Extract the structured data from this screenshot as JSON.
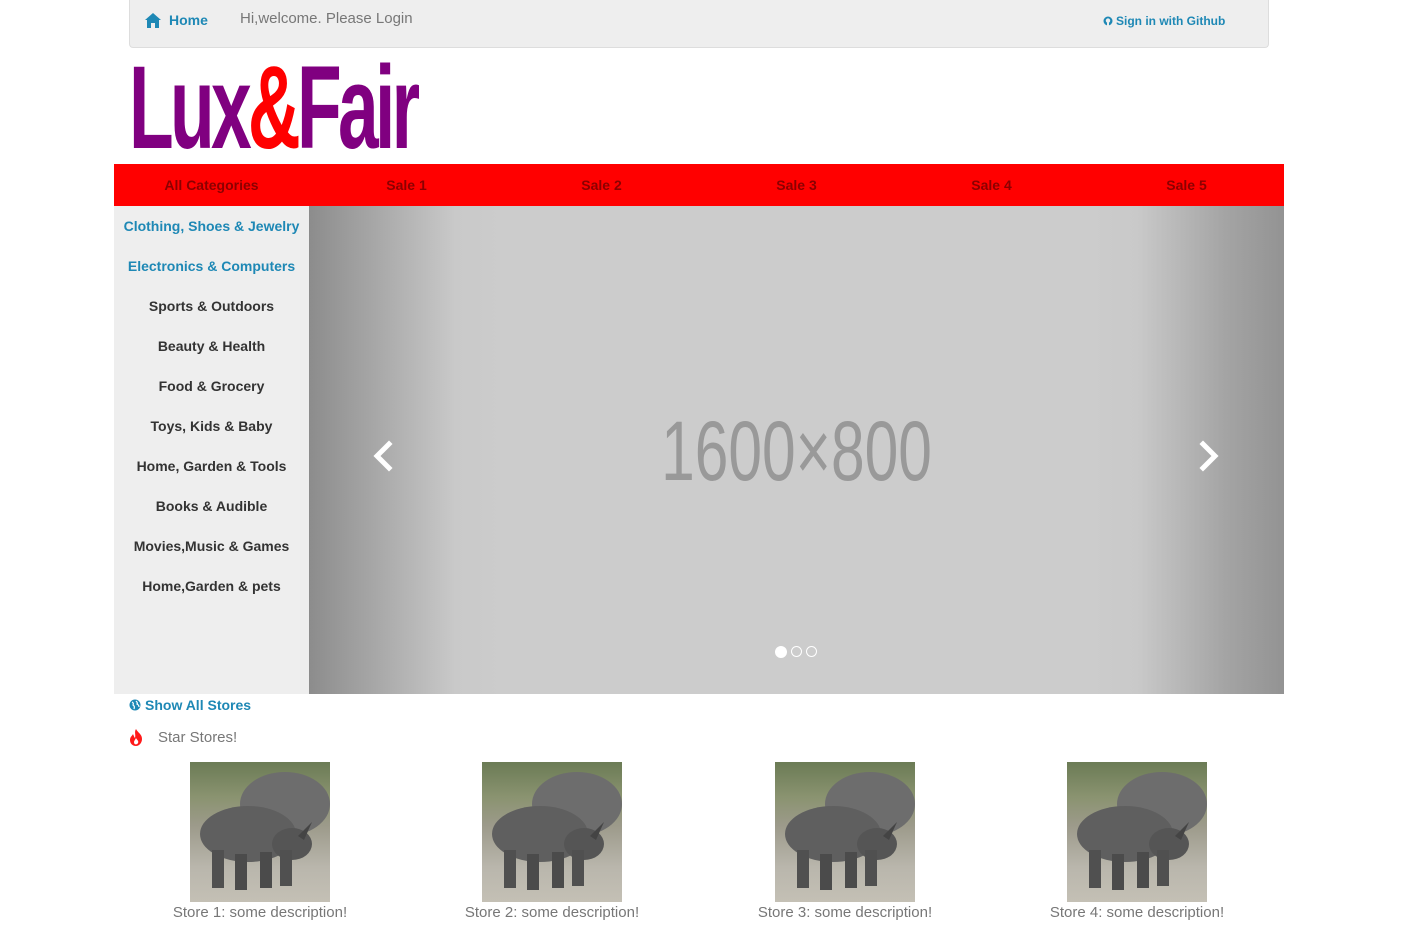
{
  "topbar": {
    "home_label": "Home",
    "welcome_text": "Hi,welcome. Please Login",
    "github_label": "Sign in with Github"
  },
  "logo": {
    "part1": "Lux",
    "amp": "&",
    "part2": "Fair",
    "color_primary": "#800080",
    "color_accent": "#ff0000"
  },
  "nav": {
    "items": [
      "All Categories",
      "Sale 1",
      "Sale 2",
      "Sale 3",
      "Sale 4",
      "Sale 5"
    ],
    "background": "#ff0000"
  },
  "categories": [
    "Clothing, Shoes & Jewelry",
    "Electronics & Computers",
    "Sports & Outdoors",
    "Beauty & Health",
    "Food & Grocery",
    "Toys, Kids & Baby",
    "Home, Garden & Tools",
    "Books & Audible",
    "Movies,Music & Games",
    "Home,Garden & pets"
  ],
  "carousel": {
    "slide_text": "1600×800",
    "prev_icon": "chevron-left-icon",
    "next_icon": "chevron-right-icon",
    "active_index": 0,
    "slide_count": 3
  },
  "stores_section": {
    "show_all_label": "Show All Stores",
    "star_label": "Star Stores!",
    "stores": [
      "Store 1: some description!",
      "Store 2: some description!",
      "Store 3: some description!",
      "Store 4: some description!"
    ]
  }
}
